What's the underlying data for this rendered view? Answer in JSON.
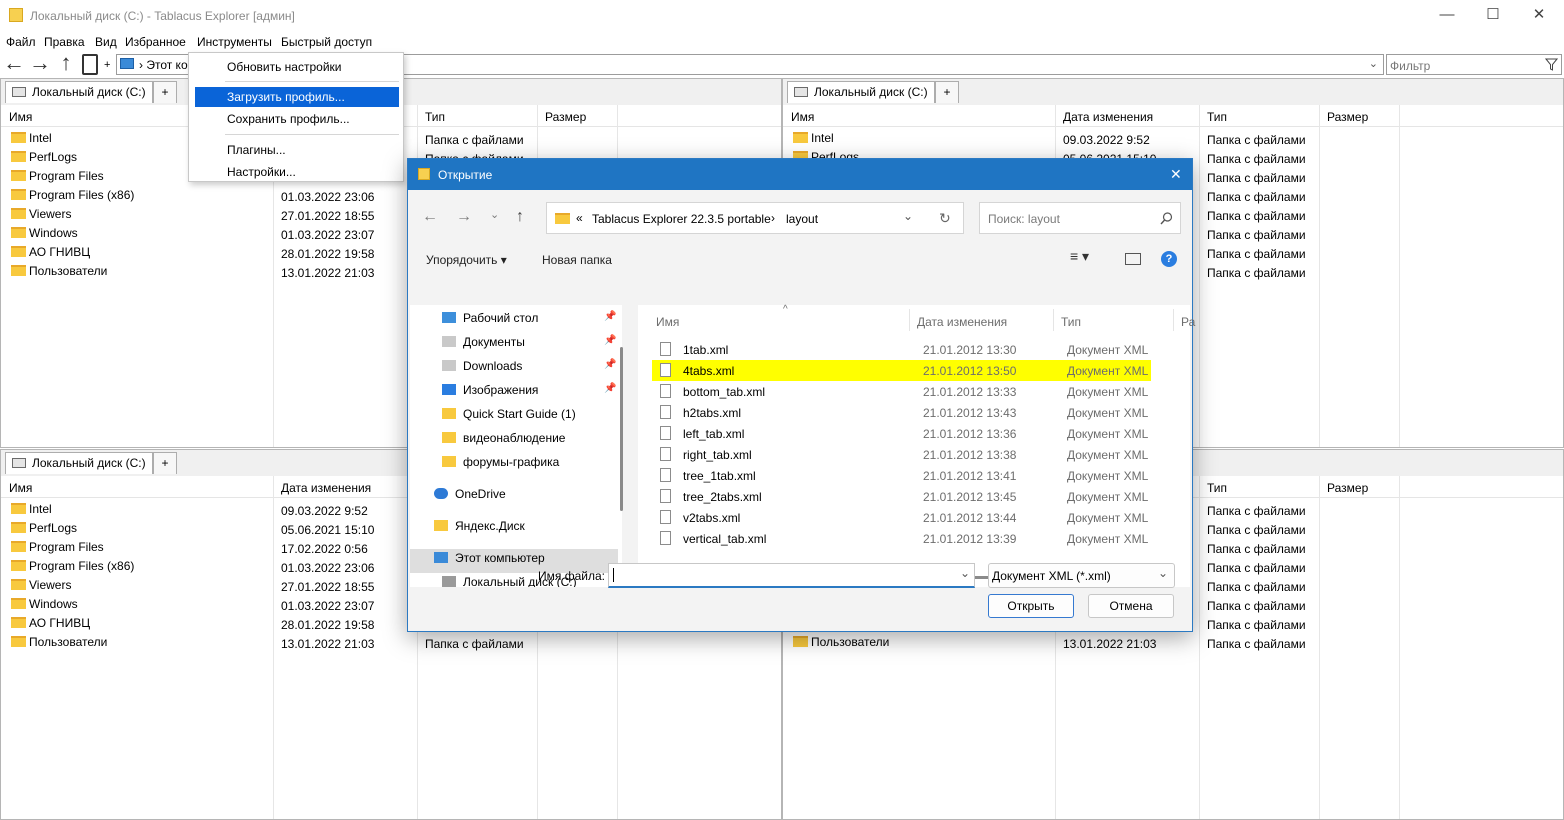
{
  "window": {
    "title": "Локальный диск (C:) - Tablacus Explorer [админ]",
    "minimize": "—",
    "maximize": "☐",
    "close": "✕"
  },
  "menubar": [
    "Файл",
    "Правка",
    "Вид",
    "Избранное",
    "Инструменты",
    "Быстрый доступ"
  ],
  "toolbar": {
    "address_text": "› Этот ко",
    "filter_placeholder": "Фильтр",
    "plus": "+"
  },
  "tools_menu": {
    "items": [
      "Обновить настройки",
      "Загрузить профиль...",
      "Сохранить профиль...",
      "Плагины...",
      "Настройки..."
    ],
    "selected_index": 1
  },
  "panes": {
    "tab_label": "Локальный диск (C:)",
    "tab_plus": "+",
    "columns": [
      "Имя",
      "Дата изменения",
      "Тип",
      "Размер"
    ],
    "folder_type": "Папка с файлами",
    "top_left": {
      "names": [
        "Intel",
        "PerfLogs",
        "Program Files",
        "Program Files (x86)",
        "Viewers",
        "Windows",
        "АО ГНИВЦ",
        "Пользователи"
      ],
      "dates": [
        "",
        "",
        "",
        "01.03.2022 23:06",
        "27.01.2022 18:55",
        "01.03.2022 23:07",
        "28.01.2022 19:58",
        "13.01.2022 21:03"
      ],
      "types": [
        "Папка с файлами",
        "Папка с файлами"
      ]
    },
    "top_right": {
      "names": [
        "Intel",
        "PerfLogs"
      ],
      "dates": [
        "09.03.2022 9:52",
        "05.06.2021 15:10"
      ],
      "types": [
        "Папка с файлами",
        "Папка с файлами",
        "Папка с файлами",
        "Папка с файлами",
        "Папка с файлами",
        "Папка с файлами",
        "Папка с файлами",
        "Папка с файлами"
      ]
    },
    "bottom_left": {
      "names": [
        "Intel",
        "PerfLogs",
        "Program Files",
        "Program Files (x86)",
        "Viewers",
        "Windows",
        "АО ГНИВЦ",
        "Пользователи"
      ],
      "dates": [
        "09.03.2022 9:52",
        "05.06.2021 15:10",
        "17.02.2022 0:56",
        "01.03.2022 23:06",
        "27.01.2022 18:55",
        "01.03.2022 23:07",
        "28.01.2022 19:58",
        "13.01.2022 21:03"
      ],
      "last_type": "Папка с файлами"
    },
    "bottom_right": {
      "last_name": "Пользователи",
      "last_date": "13.01.2022 21:03",
      "types": [
        "Папка с файлами",
        "Папка с файлами",
        "Папка с файлами",
        "Папка с файлами",
        "Папка с файлами",
        "Папка с файлами",
        "Папка с файлами",
        "Папка с файлами"
      ]
    }
  },
  "dialog": {
    "title": "Открытие",
    "close": "✕",
    "path_prefix": "«",
    "path_parts": [
      "Tablacus Explorer 22.3.5 portable",
      "layout"
    ],
    "path_sep": "›",
    "search_placeholder": "Поиск: layout",
    "organize": "Упорядочить",
    "new_folder": "Новая папка",
    "nav_items": [
      "Рабочий стол",
      "Документы",
      "Downloads",
      "Изображения",
      "Quick Start Guide (1)",
      "видеонаблюдение",
      "форумы-графика",
      "OneDrive",
      "Яндекс.Диск",
      "Этот компьютер",
      "Локальный диск (C:)"
    ],
    "file_columns": [
      "Имя",
      "Дата изменения",
      "Тип",
      "Ра"
    ],
    "files": [
      {
        "name": "1tab.xml",
        "date": "21.01.2012 13:30",
        "type": "Документ XML"
      },
      {
        "name": "4tabs.xml",
        "date": "21.01.2012 13:50",
        "type": "Документ XML"
      },
      {
        "name": "bottom_tab.xml",
        "date": "21.01.2012 13:33",
        "type": "Документ XML"
      },
      {
        "name": "h2tabs.xml",
        "date": "21.01.2012 13:43",
        "type": "Документ XML"
      },
      {
        "name": "left_tab.xml",
        "date": "21.01.2012 13:36",
        "type": "Документ XML"
      },
      {
        "name": "right_tab.xml",
        "date": "21.01.2012 13:38",
        "type": "Документ XML"
      },
      {
        "name": "tree_1tab.xml",
        "date": "21.01.2012 13:41",
        "type": "Документ XML"
      },
      {
        "name": "tree_2tabs.xml",
        "date": "21.01.2012 13:45",
        "type": "Документ XML"
      },
      {
        "name": "v2tabs.xml",
        "date": "21.01.2012 13:44",
        "type": "Документ XML"
      },
      {
        "name": "vertical_tab.xml",
        "date": "21.01.2012 13:39",
        "type": "Документ XML"
      }
    ],
    "highlighted_file": 1,
    "filename_label": "Имя файла:",
    "filename_value": "",
    "filetype": "Документ XML (*.xml)",
    "open_button": "Открыть",
    "cancel_button": "Отмена"
  },
  "colors": {
    "accent": "#0a64d8",
    "dialog_title": "#1f75c3",
    "highlight": "#ffff00",
    "folder": "#f8c93e"
  }
}
